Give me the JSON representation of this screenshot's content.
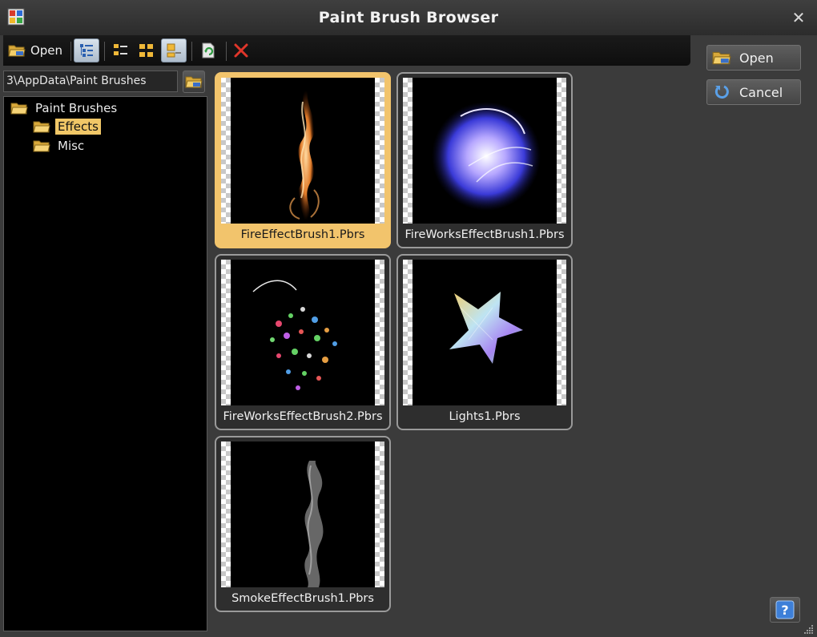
{
  "window": {
    "title": "Paint Brush Browser"
  },
  "toolbar": {
    "open_label": "Open"
  },
  "path": {
    "value": "3\\AppData\\Paint Brushes"
  },
  "tree": {
    "root": "Paint Brushes",
    "children": [
      "Effects",
      "Misc"
    ],
    "selected": "Effects"
  },
  "brushes": [
    {
      "name": "FireEffectBrush1.Pbrs",
      "selected": true
    },
    {
      "name": "FireWorksEffectBrush1.Pbrs",
      "selected": false
    },
    {
      "name": "FireWorksEffectBrush2.Pbrs",
      "selected": false
    },
    {
      "name": "Lights1.Pbrs",
      "selected": false
    },
    {
      "name": "SmokeEffectBrush1.Pbrs",
      "selected": false
    }
  ],
  "actions": {
    "open_label": "Open",
    "cancel_label": "Cancel",
    "help_label": "?"
  },
  "colors": {
    "selection": "#f2c46c",
    "window_bg": "#3b3b3b",
    "folder": "#f1c15a"
  }
}
